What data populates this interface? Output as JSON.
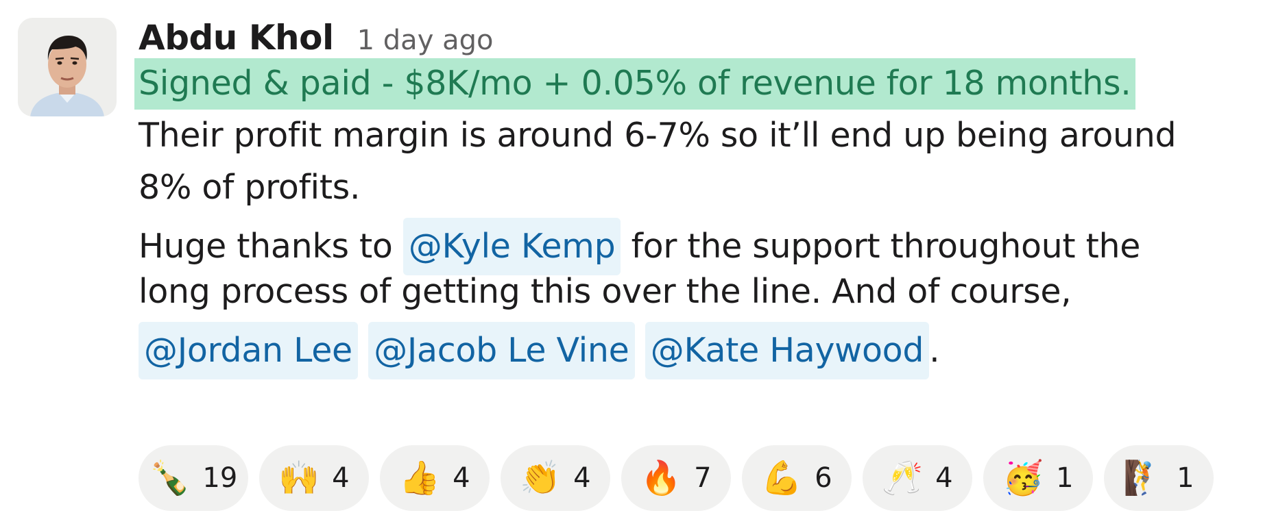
{
  "message": {
    "author": "Abdu Khol",
    "timestamp": "1 day ago",
    "highlight_text": "Signed & paid - $8K/mo + 0.05% of revenue for 18 months.",
    "line2": "Their profit margin is around 6-7% so it’ll end up being around",
    "line3": "8% of profits.",
    "line4_prefix": "Huge thanks to ",
    "line4_suffix": " for the support throughout the",
    "line5": "long process of getting this over the line. And of course,",
    "line6_end": ".",
    "mentions": [
      "@Kyle Kemp",
      "@Jordan Lee",
      "@Jacob Le Vine",
      "@Kate Haywood"
    ]
  },
  "reactions": [
    {
      "icon": "champagne-bottle-icon",
      "emoji": "🍾",
      "count": "19"
    },
    {
      "icon": "raised-hands-icon",
      "emoji": "🙌",
      "count": "4"
    },
    {
      "icon": "thumbs-up-icon",
      "emoji": "👍",
      "count": "4"
    },
    {
      "icon": "clapping-hands-icon",
      "emoji": "👏",
      "count": "4"
    },
    {
      "icon": "fire-icon",
      "emoji": "🔥",
      "count": "7"
    },
    {
      "icon": "flexed-biceps-icon",
      "emoji": "💪",
      "count": "6"
    },
    {
      "icon": "clinking-glasses-icon",
      "emoji": "🥂",
      "count": "4"
    },
    {
      "icon": "partying-face-icon",
      "emoji": "🥳",
      "count": "1"
    },
    {
      "icon": "person-climbing-icon",
      "emoji": "🧗",
      "count": "1"
    }
  ],
  "colors": {
    "highlight_bg": "#b2e9cf",
    "highlight_text": "#1f7a52",
    "mention_bg": "#e8f4fa",
    "mention_text": "#1264a3"
  }
}
